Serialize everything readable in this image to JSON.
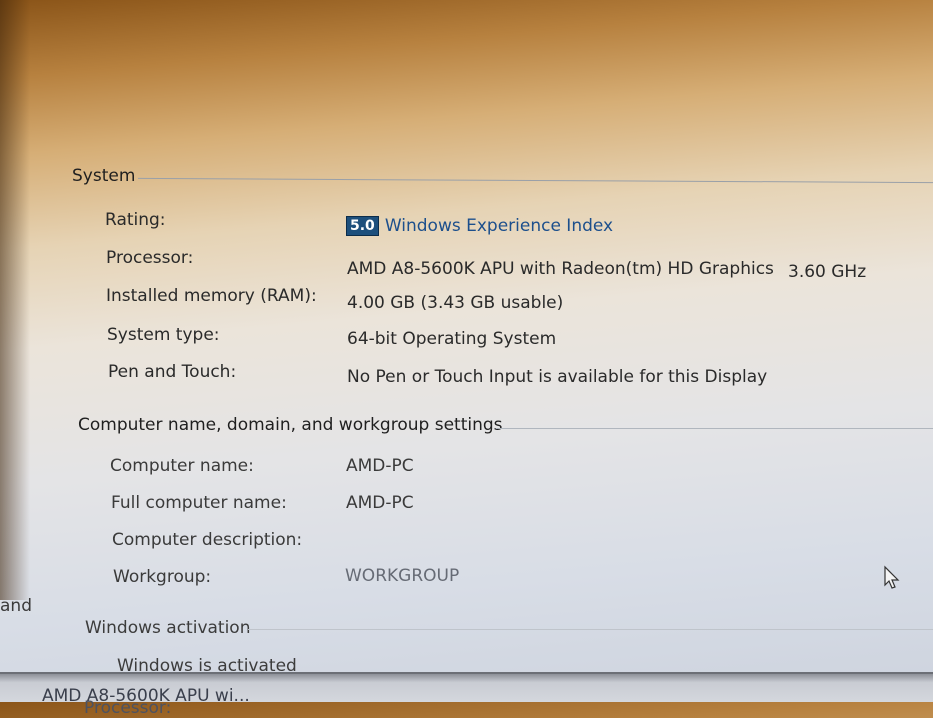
{
  "system": {
    "heading": "System",
    "rows": [
      {
        "label": "Rating:",
        "badge": "5.0",
        "value": "Windows Experience Index"
      },
      {
        "label": "Processor:",
        "value": "AMD A8-5600K APU with Radeon(tm) HD Graphics",
        "extra": "3.60 GHz"
      },
      {
        "label": "Installed memory (RAM):",
        "value": "4.00 GB (3.43 GB usable)"
      },
      {
        "label": "System type:",
        "value": "64-bit Operating System"
      },
      {
        "label": "Pen and Touch:",
        "value": "No Pen or Touch Input is available for this Display"
      }
    ]
  },
  "computer": {
    "heading": "Computer name, domain, and workgroup settings",
    "rows": [
      {
        "label": "Computer name:",
        "value": "AMD-PC"
      },
      {
        "label": "Full computer name:",
        "value": "AMD-PC"
      },
      {
        "label": "Computer description:",
        "value": ""
      },
      {
        "label": "Workgroup:",
        "value": "WORKGROUP"
      }
    ]
  },
  "side_fragment": "and",
  "activation": {
    "heading": "Windows activation",
    "status": "Windows is activated"
  },
  "taskbar_preview": {
    "label": "Processor:",
    "value": "AMD A8-5600K APU wi..."
  }
}
